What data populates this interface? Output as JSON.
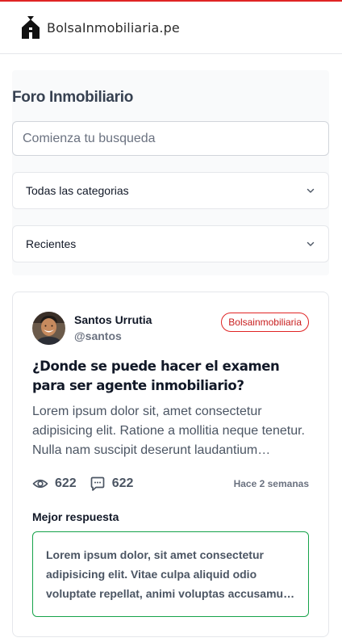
{
  "header": {
    "logo_text": "BolsaInmobiliaria.pe",
    "accent_color": "#e02424"
  },
  "filters": {
    "title": "Foro Inmobiliario",
    "search_placeholder": "Comienza tu busqueda",
    "category_select": {
      "value": "Todas las categorias"
    },
    "sort_select": {
      "value": "Recientes"
    }
  },
  "post": {
    "author_name": "Santos Urrutia",
    "author_handle": "@santos",
    "badge": "Bolsainmobiliaria",
    "title": "¿Donde se puede hacer el examen para ser agente inmobiliario?",
    "excerpt": "Lorem ipsum dolor sit, amet consectetur adipisicing elit. Ratione a mollitia neque tenetur. Nulla nam suscipit deserunt laudantium…",
    "views": "622",
    "comments": "622",
    "time": "Hace 2 semanas",
    "best_answer_label": "Mejor respuesta",
    "best_answer_text": "Lorem ipsum dolor, sit amet consectetur adipisicing elit. Vitae culpa aliquid odio voluptate repellat, animi voluptas accusamus saepe…",
    "best_answer_color": "#16a34a"
  },
  "icons": {
    "logo": "house-bag-icon",
    "views": "eye-icon",
    "comments": "chat-bubble-icon",
    "dropdown": "chevron-down-icon"
  }
}
